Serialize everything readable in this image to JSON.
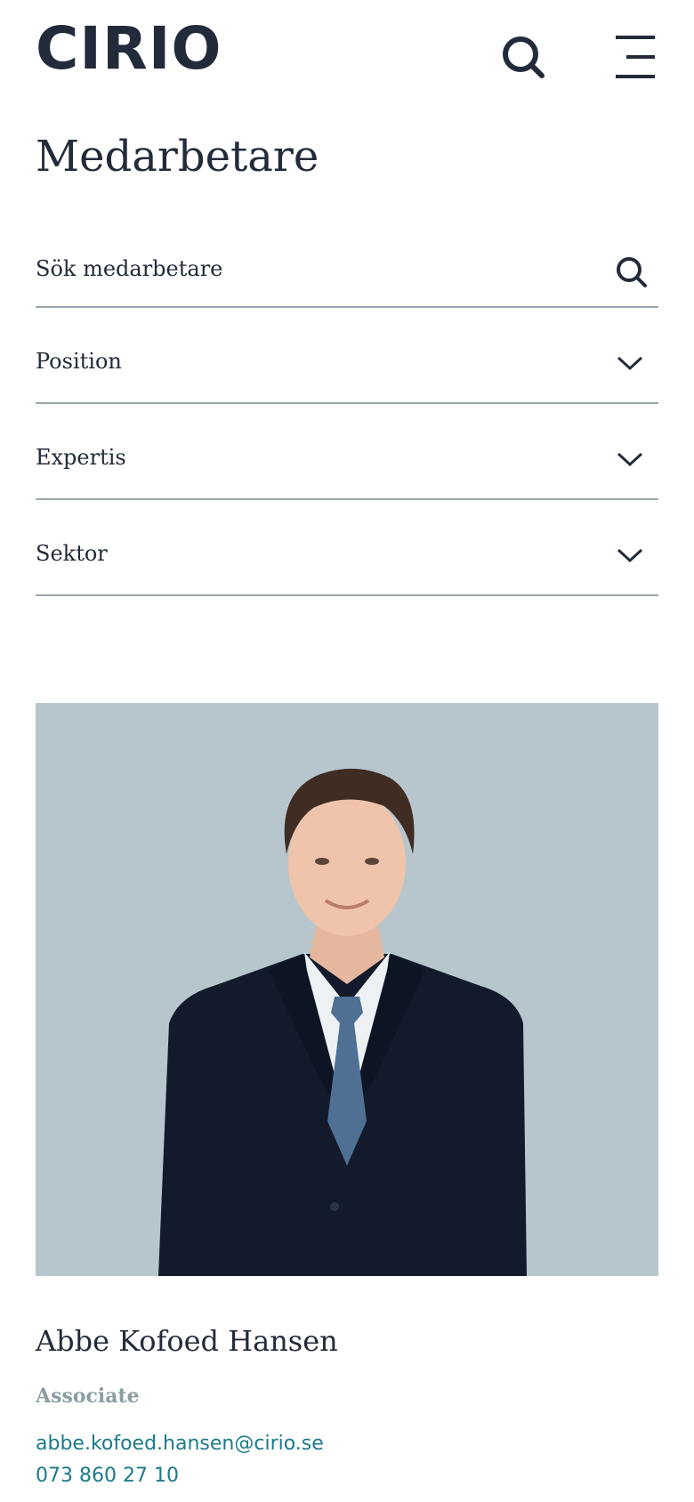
{
  "header": {
    "logo": "CIRIO",
    "search_icon": "search-icon",
    "menu_icon": "menu-icon"
  },
  "page": {
    "title": "Medarbetare"
  },
  "filters": {
    "search": {
      "placeholder": "Sök medarbetare",
      "value": ""
    },
    "items": [
      {
        "label": "Position"
      },
      {
        "label": "Expertis"
      },
      {
        "label": "Sektor"
      }
    ]
  },
  "employees": [
    {
      "name": "Abbe Kofoed Hansen",
      "role": "Associate",
      "email": "abbe.kofoed.hansen@cirio.se",
      "phone": "073 860 27 10"
    }
  ],
  "colors": {
    "text": "#232b3a",
    "accent": "#1a7a8a",
    "muted": "#8b9ea3",
    "photo_bg": "#b7c6cc",
    "divider": "#9aa7ae"
  }
}
